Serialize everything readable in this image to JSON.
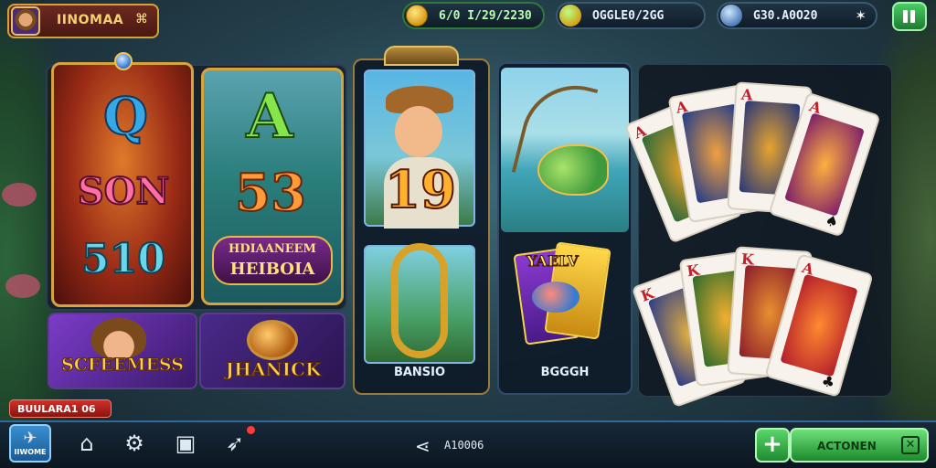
{
  "player": {
    "name": "IINOMAA",
    "badge": "⌘"
  },
  "currencies": {
    "coins": {
      "value": "6/0 I/29/2230",
      "icon": "coin-icon"
    },
    "gems": {
      "value": "OGGLE0/2GG",
      "icon": "gem-icon"
    },
    "stars": {
      "value": "G30.A0O20",
      "icon": "blue-orb-icon",
      "end": "✶"
    }
  },
  "games": {
    "card1": {
      "top": "Q",
      "mid": "SON",
      "bottom": "510"
    },
    "card2": {
      "top": "A",
      "mid": "53",
      "banner_line1": "HDIAANEEM",
      "banner_line2": "HEIBOIA"
    },
    "card3": {
      "label": "SCFEEMESS"
    },
    "card4": {
      "label": "JHANICK"
    },
    "card5": {
      "number": "19",
      "caption": "BANSIO"
    },
    "card6": {
      "caption": "BGGGH",
      "mini_text": "YAELV"
    }
  },
  "playing_cards": [
    {
      "rank": "A",
      "suit": "♣"
    },
    {
      "rank": "A",
      "suit": "♠"
    },
    {
      "rank": "A",
      "suit": "♠"
    },
    {
      "rank": "A",
      "suit": "♠"
    },
    {
      "rank": "K",
      "suit": "♠"
    },
    {
      "rank": "K",
      "suit": "♣"
    },
    {
      "rank": "K",
      "suit": "♠"
    },
    {
      "rank": "A",
      "suit": "♣"
    }
  ],
  "status": {
    "text": "BUULARA1 06"
  },
  "bottom_nav": {
    "active_label": "IIWOME",
    "share_text": "A10006",
    "action_label": "ACTONEN",
    "add_label": "+",
    "close_label": "✕"
  }
}
